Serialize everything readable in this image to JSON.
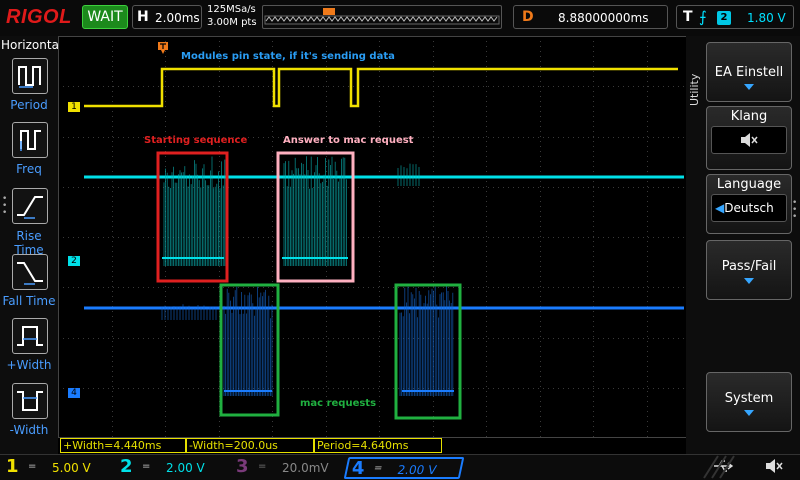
{
  "header": {
    "brand": "RIGOL",
    "run_status": "WAIT",
    "horizontal_label": "H",
    "timebase": "2.00ms",
    "sample_rate": "125MSa/s",
    "memory_depth": "3.00M pts",
    "delay_label": "D",
    "delay_value": "8.88000000ms",
    "trigger_label": "T",
    "trigger_source": "2",
    "trigger_level": "1.80 V"
  },
  "left_panel": {
    "title": "Horizontal",
    "items": [
      {
        "label": "Period",
        "icon": "period-icon"
      },
      {
        "label": "Freq",
        "icon": "frequency-icon"
      },
      {
        "label": "Rise Time",
        "icon": "rise-time-icon"
      },
      {
        "label": "Fall Time",
        "icon": "fall-time-icon"
      },
      {
        "label": "+Width",
        "icon": "positive-width-icon"
      },
      {
        "label": "-Width",
        "icon": "negative-width-icon"
      }
    ]
  },
  "right_panel": {
    "side_label": "Utility",
    "items": [
      {
        "label": "EA Einstell"
      },
      {
        "label": "Klang",
        "value_icon": "speaker-muted-icon"
      },
      {
        "label": "Language",
        "value": "Deutsch"
      },
      {
        "label": "Pass/Fail"
      },
      {
        "label": "System"
      }
    ]
  },
  "annotations": {
    "top_note": "Modules pin state, if it's sending data",
    "starting_sequence": "Starting sequence",
    "answer": "Answer to mac request",
    "mac_requests": "mac requests"
  },
  "channel_markers": [
    "1",
    "2",
    "4"
  ],
  "measurements": [
    {
      "text": "+Width=4.440ms"
    },
    {
      "text": "-Width=200.0us"
    },
    {
      "text": "Period=4.640ms"
    }
  ],
  "channels": [
    {
      "num": "1",
      "coupling": "=",
      "scale": "5.00 V",
      "color": "#f0e000"
    },
    {
      "num": "2",
      "coupling": "=",
      "scale": "2.00 V",
      "color": "#00e0e8"
    },
    {
      "num": "3",
      "coupling": "=",
      "scale": "20.0mV",
      "color": "#c060c0"
    },
    {
      "num": "4",
      "coupling": "=",
      "scale": "2.00 V",
      "color": "#1a7cff"
    }
  ],
  "colors": {
    "ch1": "#f0e000",
    "ch2": "#00e0e8",
    "ch4": "#1a7cff",
    "annotation_red": "#e02020",
    "annotation_pink": "#ffb0c0",
    "annotation_green": "#20b040",
    "annotation_blue_text": "#2a9df4",
    "trigger_orange": "#f07a1a"
  }
}
